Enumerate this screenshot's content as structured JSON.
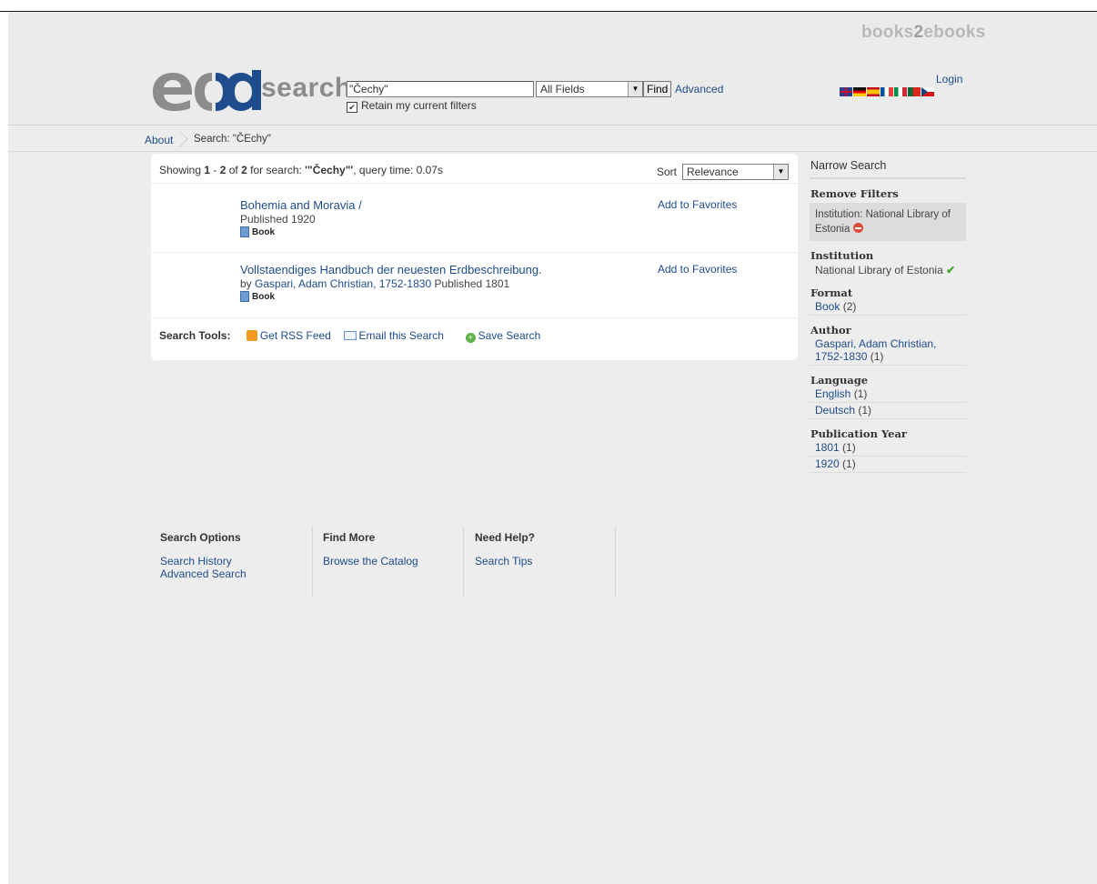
{
  "header": {
    "brand_prefix": "books",
    "brand_two": "2",
    "brand_suffix": "ebooks",
    "logo_word": "search",
    "search_value": "\"Čechy\"",
    "search_type": "All Fields",
    "find_label": "Find",
    "advanced_label": "Advanced",
    "retain_label": "Retain my current filters",
    "retain_checked": "✔",
    "login_label": "Login",
    "flags": [
      "en",
      "de",
      "es",
      "fr",
      "it",
      "pt",
      "cz"
    ]
  },
  "breadcrumb": {
    "about": "About",
    "current": "Search: \"ČEchy\""
  },
  "results": {
    "showing_prefix": "Showing ",
    "range_start": "1",
    "range_sep": " - ",
    "range_end": "2",
    "of": " of ",
    "total": "2",
    "for_search": " for search: ",
    "query": "'\"Čechy\"'",
    "query_time": ", query time: 0.07s",
    "sort_label": "Sort",
    "sort_value": "Relevance",
    "records": [
      {
        "title": "Bohemia and Moravia /",
        "by": "",
        "author": "",
        "published": "Published 1920",
        "format": "Book",
        "favorite": "Add to Favorites"
      },
      {
        "title": "Vollstaendiges Handbuch der neuesten Erdbeschreibung.",
        "by": "by ",
        "author": "Gaspari, Adam Christian, 1752-1830",
        "published": " Published 1801",
        "format": "Book",
        "favorite": "Add to Favorites"
      }
    ],
    "tools_label": "Search Tools:",
    "rss": "Get RSS Feed",
    "email": "Email this Search",
    "save": "Save Search"
  },
  "sidebar": {
    "title": "Narrow Search",
    "remove_heading": "Remove Filters",
    "remove_filter": "Institution: National Library of Estonia",
    "institution_heading": "Institution",
    "institution_value": "National Library of Estonia",
    "format_heading": "Format",
    "format_items": [
      {
        "label": "Book",
        "count": " (2)"
      }
    ],
    "author_heading": "Author",
    "author_items": [
      {
        "label": "Gaspari, Adam Christian, 1752-1830",
        "count": " (1)"
      }
    ],
    "language_heading": "Language",
    "language_items": [
      {
        "label": "English",
        "count": " (1)"
      },
      {
        "label": "Deutsch",
        "count": " (1)"
      }
    ],
    "year_heading": "Publication Year",
    "year_items": [
      {
        "label": "1801",
        "count": " (1)"
      },
      {
        "label": "1920",
        "count": " (1)"
      }
    ]
  },
  "footer": {
    "columns": [
      {
        "heading": "Search Options",
        "links": [
          "Search History",
          "Advanced Search"
        ]
      },
      {
        "heading": "Find More",
        "links": [
          "Browse the Catalog"
        ]
      },
      {
        "heading": "Need Help?",
        "links": [
          "Search Tips"
        ]
      }
    ]
  },
  "colors": {
    "link": "#1e4c8c",
    "background": "#ededed",
    "logo_gray": "#8c8c8c",
    "logo_blue": "#1e4c8c"
  }
}
